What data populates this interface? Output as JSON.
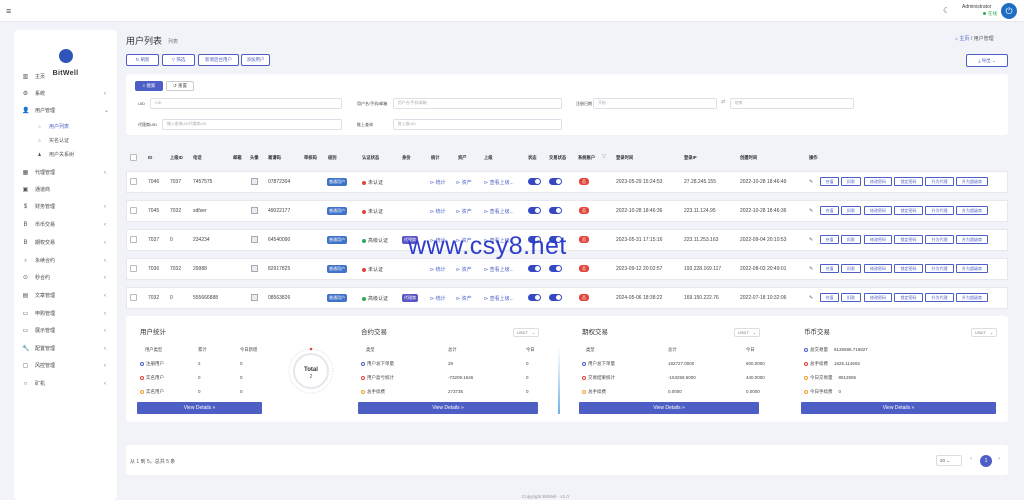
{
  "topbar": {
    "admin_name": "Administrator",
    "admin_status": "在线"
  },
  "brand": {
    "name": "BitWell"
  },
  "sidebar": {
    "items": [
      {
        "icon": "▥",
        "label": "主页",
        "chevron": ""
      },
      {
        "icon": "⚙",
        "label": "系统",
        "chevron": "‹"
      },
      {
        "icon": "👤",
        "label": "用户管理",
        "chevron": "⌄"
      },
      {
        "icon": "○",
        "label": "用户列表",
        "chevron": "",
        "sub": true,
        "active": true
      },
      {
        "icon": "○",
        "label": "实名认证",
        "chevron": "",
        "sub": true
      },
      {
        "icon": "♟",
        "label": "用户关系树",
        "chevron": "",
        "sub": true
      },
      {
        "icon": "▦",
        "label": "代理管理",
        "chevron": "‹"
      },
      {
        "icon": "▣",
        "label": "通道商",
        "chevron": ""
      },
      {
        "icon": "$",
        "label": "财务管理",
        "chevron": "‹"
      },
      {
        "icon": "B",
        "label": "币币交易",
        "chevron": "‹"
      },
      {
        "icon": "B",
        "label": "期权交易",
        "chevron": "‹"
      },
      {
        "icon": "♁",
        "label": "永续合约",
        "chevron": "‹"
      },
      {
        "icon": "⊙",
        "label": "秒合约",
        "chevron": "‹"
      },
      {
        "icon": "▤",
        "label": "文章管理",
        "chevron": "‹"
      },
      {
        "icon": "▭",
        "label": "申购管理",
        "chevron": "‹"
      },
      {
        "icon": "▭",
        "label": "展示管理",
        "chevron": "‹"
      },
      {
        "icon": "🔧",
        "label": "配置管理",
        "chevron": "‹"
      },
      {
        "icon": "▢",
        "label": "风控管理",
        "chevron": "‹"
      },
      {
        "icon": "○",
        "label": "矿机",
        "chevron": "‹"
      }
    ]
  },
  "header": {
    "title": "用户列表",
    "subtitle": "列表",
    "breadcrumb_home": "主页",
    "breadcrumb_sep": "/",
    "breadcrumb_current": "用户管理"
  },
  "toolbar": {
    "refresh": "刷新",
    "filter": "筛选",
    "add_agent": "新增后台用户",
    "add_user": "添加用户",
    "export": "导出"
  },
  "search": {
    "search_btn": "搜索",
    "reset_btn": "重置",
    "uid_label": "UID",
    "uid_ph": "UID",
    "user_label": "用户名/手机/邮箱",
    "user_ph": "用户名/手机/邮箱",
    "reg_label": "注册日期",
    "reg_start_ph": "开始",
    "reg_end_ph": "结束",
    "agent_label": "代理商UID",
    "agent_ph": "输入查询UID代理商UID",
    "parent_label": "推上查询",
    "parent_ph": "推上级UID"
  },
  "table": {
    "headers": [
      "ID",
      "上级ID",
      "电话",
      "邮箱",
      "头像",
      "邀请码",
      "审核码",
      "级别",
      "认证状态",
      "身份",
      "统计",
      "资产",
      "上级",
      "状态",
      "交易状态",
      "系统账户",
      "登录时间",
      "登录IP",
      "创建时间",
      "操作"
    ],
    "rows": [
      {
        "id": "7046",
        "pid": "7037",
        "phone": "7457575",
        "code": "07872304",
        "level": "普通用户",
        "auth": "未认证",
        "auth_color": "#e2443c",
        "identity": "",
        "stat": "统计",
        "asset": "资产",
        "parent": "查看上级...",
        "sys": "否",
        "login_time": "2023-05-29 15:24:53",
        "ip": "27.28.245.155",
        "created": "2022-10-28 18:46:49"
      },
      {
        "id": "7045",
        "pid": "7032",
        "phone": "sdfser",
        "code": "49022177",
        "level": "普通用户",
        "auth": "未认证",
        "auth_color": "#e2443c",
        "identity": "",
        "stat": "统计",
        "asset": "资产",
        "parent": "查看上级...",
        "sys": "否",
        "login_time": "2022-10-28 18:46:36",
        "ip": "223.11.124.95",
        "created": "2022-10-28 18:46:36"
      },
      {
        "id": "7037",
        "pid": "0",
        "phone": "234234",
        "code": "64540090",
        "level": "普通用户",
        "auth": "高级认证",
        "auth_color": "#2eaa52",
        "identity": "代理商",
        "stat": "统计",
        "asset": "资产",
        "parent": "查看上级...",
        "sys": "否",
        "login_time": "2023-05-31 17:15:16",
        "ip": "223.11.253.163",
        "created": "2022-09-04 20:10:53"
      },
      {
        "id": "7036",
        "pid": "7032",
        "phone": "29988",
        "code": "82917825",
        "level": "普通用户",
        "auth": "未认证",
        "auth_color": "#e2443c",
        "identity": "",
        "stat": "统计",
        "asset": "资产",
        "parent": "查看上级...",
        "sys": "否",
        "login_time": "2023-09-12 20:02:57",
        "ip": "193.228.169.117",
        "created": "2022-08-03 20:49:01"
      },
      {
        "id": "7032",
        "pid": "0",
        "phone": "555666888",
        "code": "08563826",
        "level": "普通用户",
        "auth": "高级认证",
        "auth_color": "#2eaa52",
        "identity": "代理商",
        "stat": "统计",
        "asset": "资产",
        "parent": "查看上级...",
        "sys": "否",
        "login_time": "2024-05-06 18:38:22",
        "ip": "169.150.222.76",
        "created": "2022-07-18 10:32:06"
      }
    ],
    "actions": [
      "充值",
      "扣款",
      "修改密码",
      "锁定密码",
      "升为代理",
      "升为超级商"
    ]
  },
  "stats": {
    "users": {
      "title": "用户统计",
      "h1": "用户类型",
      "h2": "累计",
      "h3": "今日新增",
      "rows": [
        {
          "label": "注册用户",
          "total": "2",
          "today": "0",
          "color": "#4d5fc5"
        },
        {
          "label": "实名用户",
          "total": "0",
          "today": "0",
          "color": "#e2443c"
        },
        {
          "label": "实名用户",
          "total": "0",
          "today": "0",
          "color": "#f0a02a"
        }
      ],
      "donut_label": "Total",
      "donut_value": "2",
      "view": "View Details »"
    },
    "contract": {
      "title": "合约交易",
      "currency": "USDT",
      "h1": "类型",
      "h2": "总计",
      "h3": "今日",
      "rows": [
        {
          "label": "用户总下单量",
          "total": "29",
          "today": "0",
          "color": "#4d5fc5"
        },
        {
          "label": "用户盈亏统计",
          "total": "-73209.1646",
          "today": "0",
          "color": "#e2443c"
        },
        {
          "label": "总手续费",
          "total": "273735",
          "today": "0",
          "color": "#f0a02a"
        }
      ],
      "view": "View Details »"
    },
    "options": {
      "title": "期权交易",
      "currency": "USDT",
      "h1": "类型",
      "h2": "总计",
      "h3": "今日",
      "rows": [
        {
          "label": "用户总下单量",
          "total": "182727.0000",
          "today": "600.0000",
          "color": "#4d5fc5"
        },
        {
          "label": "交易结果统计",
          "total": "-153258.6000",
          "today": "440.0000",
          "color": "#e2443c"
        },
        {
          "label": "总手续费",
          "total": "0.0000",
          "today": "0.0000",
          "color": "#f0a02a"
        }
      ],
      "view": "View Details »"
    },
    "spot": {
      "title": "币币交易",
      "currency": "USDT",
      "rows": [
        {
          "label": "总交易量",
          "value": "8135586.716827",
          "color": "#4d5fc5"
        },
        {
          "label": "总手续费",
          "value": "1625.114692",
          "color": "#e2443c"
        },
        {
          "label": "今日交易量",
          "value": "8512906",
          "color": "#f0a02a"
        },
        {
          "label": "今日手续费",
          "value": "0",
          "color": "#f0a02a"
        }
      ],
      "view": "View Details »"
    }
  },
  "pagination": {
    "info": "从 1 到 5，总共 5 条",
    "per_page": "20",
    "current": "1",
    "prev": "‹",
    "next": "›"
  },
  "footer": {
    "copyright": "Copyright BitWell · v1.0"
  },
  "watermark": {
    "text": "www.csy8.net"
  }
}
